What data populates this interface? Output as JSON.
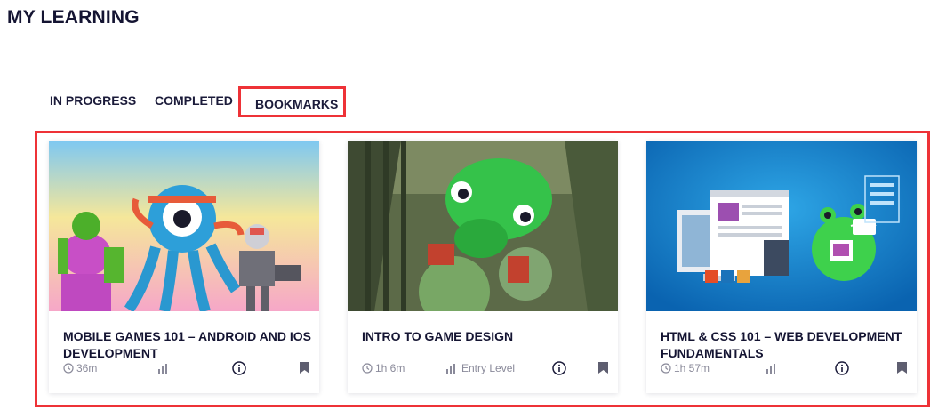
{
  "page": {
    "title": "MY LEARNING"
  },
  "tabs": [
    {
      "label": "IN PROGRESS",
      "active": false
    },
    {
      "label": "COMPLETED",
      "active": false
    },
    {
      "label": "BOOKMARKS",
      "active": true
    }
  ],
  "colors": {
    "highlight": "#ee3237",
    "text": "#141432",
    "meta": "#8a8a9a"
  },
  "cards": [
    {
      "title": "MOBILE GAMES 101 – ANDROID AND IOS DEVELOPMENT",
      "duration": "36m",
      "level": "",
      "icons": [
        "clock-icon",
        "level-bars-icon",
        "info-icon",
        "bookmark-icon"
      ]
    },
    {
      "title": "INTRO TO GAME DESIGN",
      "duration": "1h 6m",
      "level": "Entry Level",
      "icons": [
        "clock-icon",
        "level-bars-icon",
        "info-icon",
        "bookmark-icon"
      ]
    },
    {
      "title": "HTML & CSS 101 – WEB DEVELOPMENT FUNDAMENTALS",
      "duration": "1h 57m",
      "level": "",
      "icons": [
        "clock-icon",
        "level-bars-icon",
        "info-icon",
        "bookmark-icon"
      ]
    }
  ]
}
